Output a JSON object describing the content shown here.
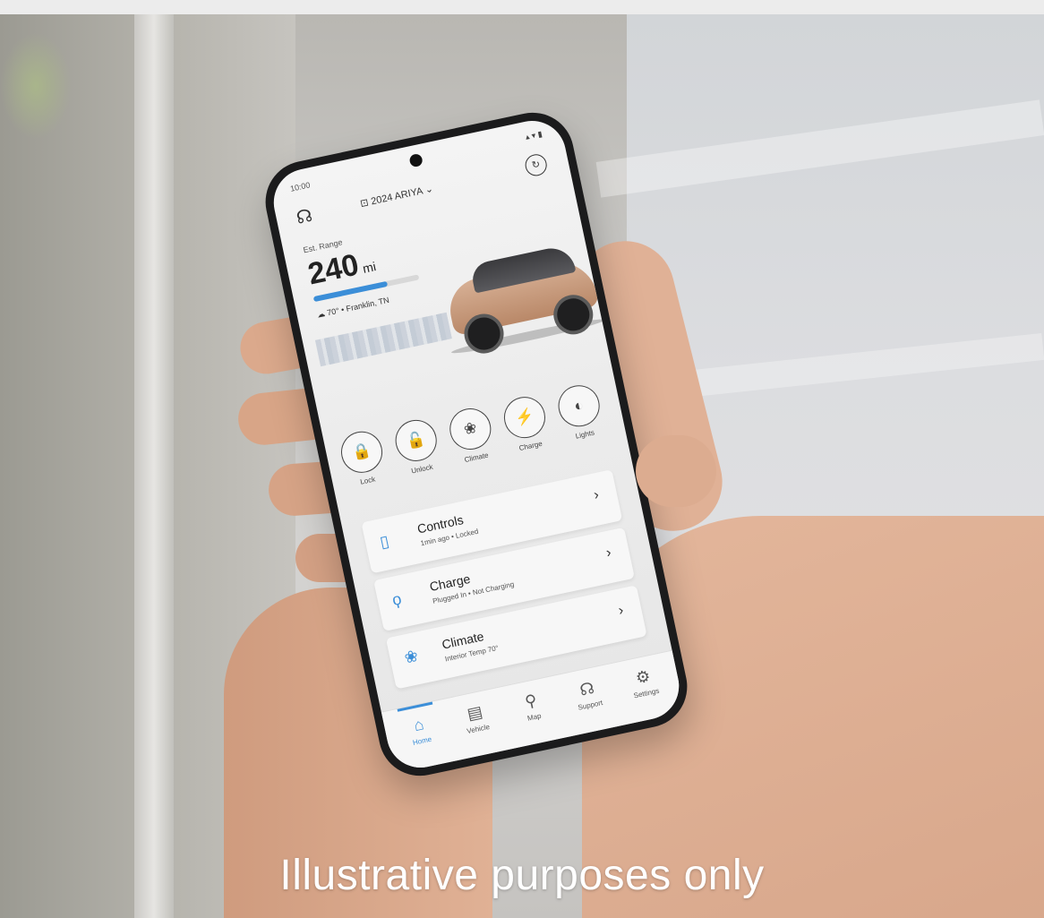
{
  "app": {
    "status_time": "10:00",
    "vehicle_selector": "2024 ARIYA",
    "est_range_label": "Est. Range",
    "range_value": "240",
    "range_unit": "mi",
    "range_fraction": 0.7,
    "weather": "70° • Franklin, TN",
    "actions": [
      {
        "label": "Lock",
        "icon": "lock-icon",
        "glyph": "🔒"
      },
      {
        "label": "Unlock",
        "icon": "unlock-icon",
        "glyph": "🔓"
      },
      {
        "label": "Climate",
        "icon": "fan-icon",
        "glyph": "❀"
      },
      {
        "label": "Charge",
        "icon": "plug-icon",
        "glyph": "⚡"
      },
      {
        "label": "Lights",
        "icon": "headlight-icon",
        "glyph": "◐"
      }
    ],
    "cards": [
      {
        "title": "Controls",
        "subtitle": "1min ago • Locked",
        "icon": "remote-icon",
        "glyph": "▯"
      },
      {
        "title": "Charge",
        "subtitle": "Plugged In • Not Charging",
        "icon": "plug-icon",
        "glyph": "ϙ"
      },
      {
        "title": "Climate",
        "subtitle": "Interior Temp 70°",
        "icon": "fan-icon",
        "glyph": "❀"
      }
    ],
    "tabs": [
      {
        "label": "Home",
        "icon": "home-icon",
        "glyph": "⌂",
        "active": true
      },
      {
        "label": "Vehicle",
        "icon": "car-icon",
        "glyph": "▤",
        "active": false
      },
      {
        "label": "Map",
        "icon": "map-pin-icon",
        "glyph": "⚲",
        "active": false
      },
      {
        "label": "Support",
        "icon": "headset-icon",
        "glyph": "☊",
        "active": false
      },
      {
        "label": "Settings",
        "icon": "gear-icon",
        "glyph": "⚙",
        "active": false
      }
    ]
  },
  "caption": "Illustrative purposes only",
  "colors": {
    "accent": "#3b8ed8",
    "caption": "#ffffff"
  }
}
